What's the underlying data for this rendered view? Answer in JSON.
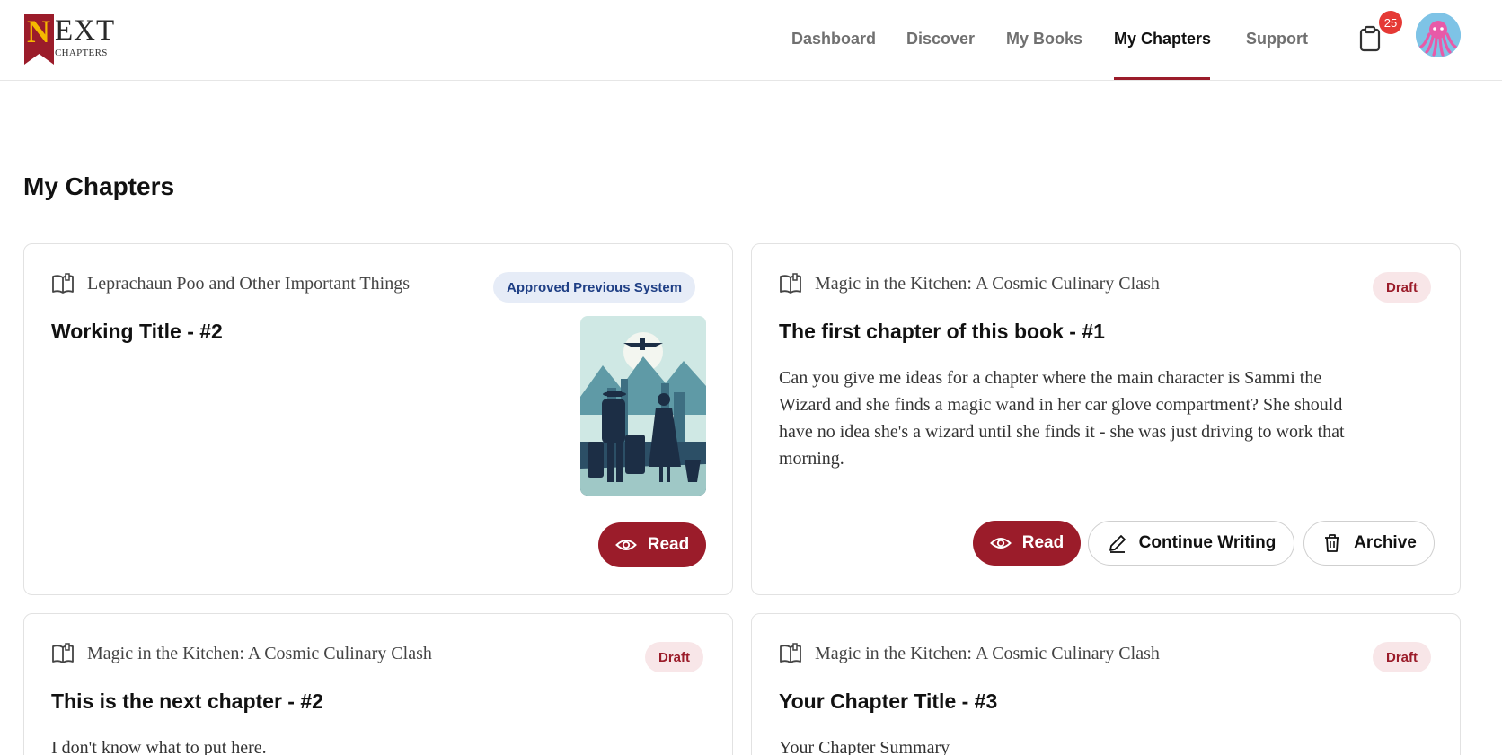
{
  "header": {
    "logo": {
      "letter": "N",
      "text": "EXT",
      "sub": "CHAPTERS"
    },
    "nav": [
      {
        "label": "Dashboard"
      },
      {
        "label": "Discover"
      },
      {
        "label": "My Books"
      },
      {
        "label": "My Chapters",
        "active": true
      },
      {
        "label": "Support"
      }
    ],
    "notifications": {
      "icon": "clipboard-icon",
      "count": "25"
    },
    "avatar": {
      "icon": "octopus-avatar"
    }
  },
  "colors": {
    "brand": "#9b1c2a",
    "approved_bg": "#e6ecf7",
    "approved_text": "#1f3f85",
    "draft_bg": "#f8e6e8",
    "notif": "#e53935"
  },
  "page": {
    "title": "My Chapters"
  },
  "cards": [
    {
      "book": "Leprachaun Poo and Other Important Things",
      "status": "Approved Previous System",
      "title": "Working Title - #2",
      "summary": "",
      "actions": {
        "read": "Read"
      }
    },
    {
      "book": "Magic in the Kitchen: A Cosmic Culinary Clash",
      "status": "Draft",
      "title": "The first chapter of this book - #1",
      "summary": "Can you give me ideas for a chapter where the main character is Sammi the Wizard and she finds a magic wand in her car glove compartment? She should have no idea she's a wizard until she finds it - she was just driving to work that morning.",
      "actions": {
        "read": "Read",
        "continue": "Continue Writing",
        "archive": "Archive"
      }
    },
    {
      "book": "Magic in the Kitchen: A Cosmic Culinary Clash",
      "status": "Draft",
      "title": "This is the next chapter - #2",
      "summary": "I don't know what to put here."
    },
    {
      "book": "Magic in the Kitchen: A Cosmic Culinary Clash",
      "status": "Draft",
      "title": "Your Chapter Title - #3",
      "summary": "Your Chapter Summary"
    }
  ]
}
